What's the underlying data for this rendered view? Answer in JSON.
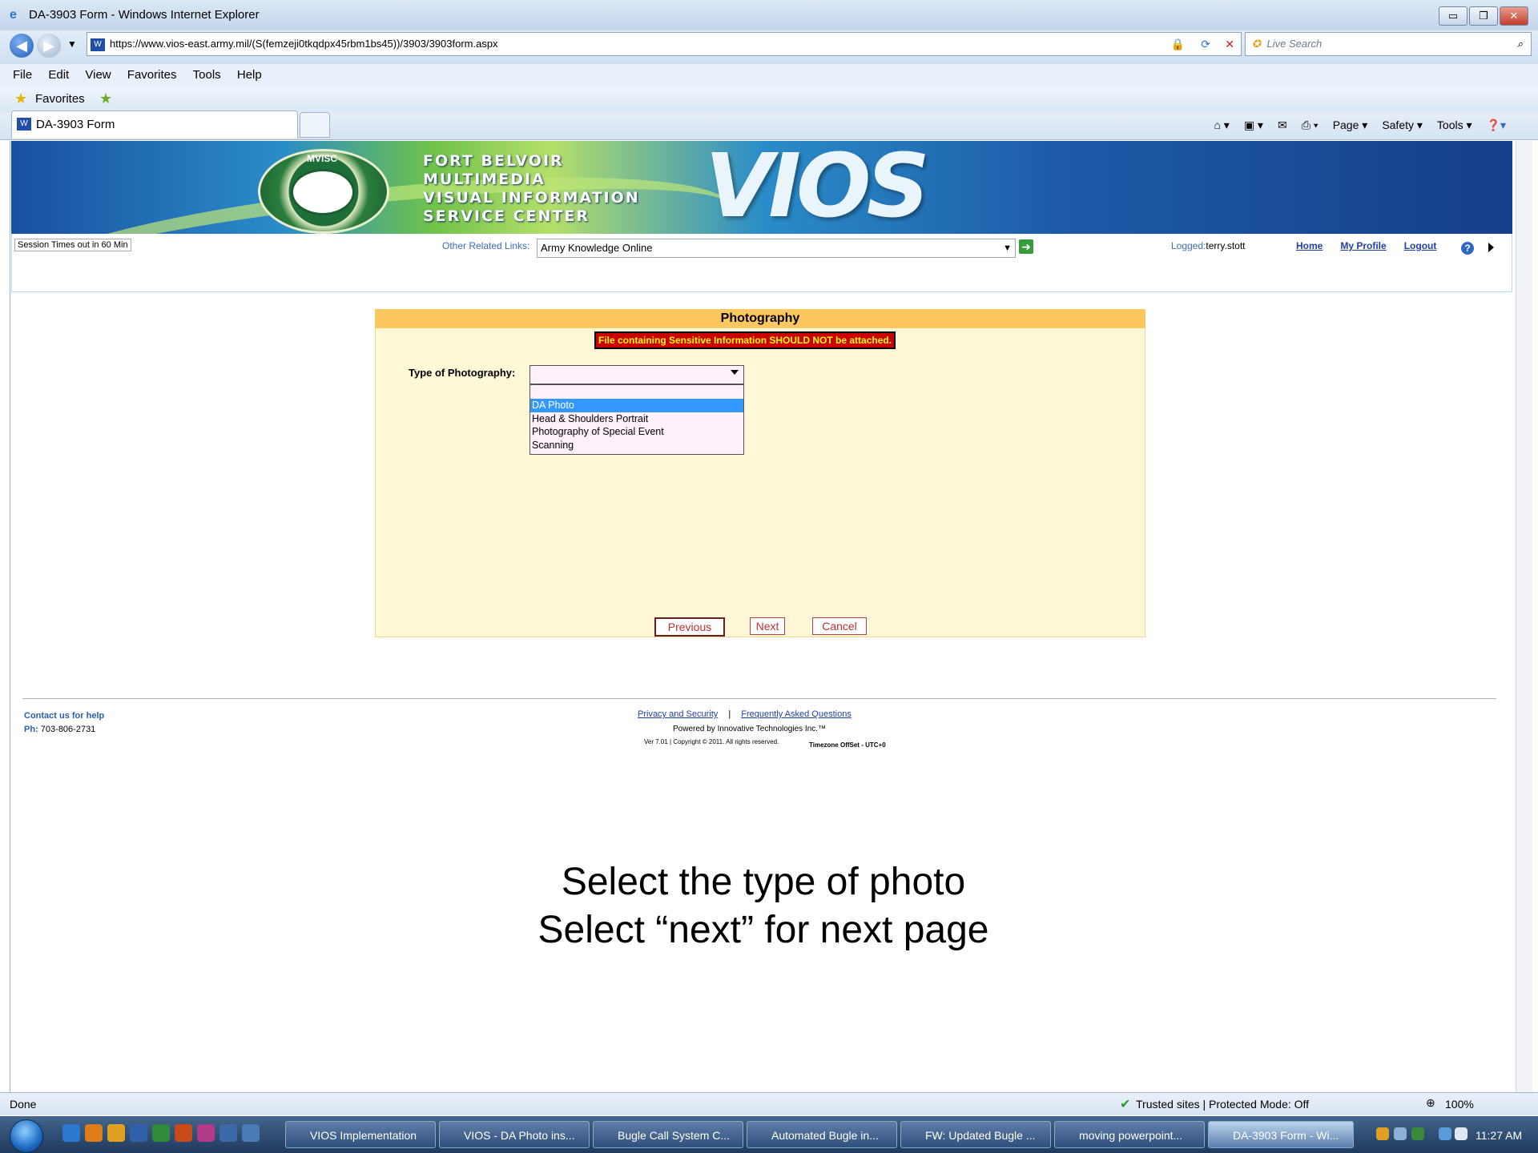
{
  "window": {
    "title": "DA-3903 Form - Windows Internet Explorer",
    "min": "▭",
    "max": "❐",
    "close": "✕"
  },
  "addressbar": {
    "url": "https://www.vios-east.army.mil/(S(femzeji0tkqdpx45rbm1bs45))/3903/3903form.aspx",
    "search_placeholder": "Live Search"
  },
  "menu": [
    "File",
    "Edit",
    "View",
    "Favorites",
    "Tools",
    "Help"
  ],
  "favorites": {
    "label": "Favorites"
  },
  "tab": {
    "label": "DA-3903 Form"
  },
  "commandbar": [
    "Page ▾",
    "Safety ▾",
    "Tools ▾"
  ],
  "banner": {
    "line1": "FORT BELVOIR",
    "line2": "MULTIMEDIA",
    "line3": "VISUAL INFORMATION",
    "line4": "SERVICE CENTER",
    "logo": "VIOS",
    "seal": "MVISC"
  },
  "header": {
    "session": "Session Times out in 60 Min",
    "other_links_label": "Other Related Links:",
    "other_links_value": "Army Knowledge Online",
    "logged_label": "Logged:",
    "logged_user": "terry.stott",
    "home": "Home",
    "profile": "My Profile",
    "logout": "Logout"
  },
  "form": {
    "title": "Photography",
    "warning": "File containing Sensitive Information SHOULD NOT be attached.",
    "type_label": "Type of Photography:",
    "options": [
      "DA Photo",
      "Head & Shoulders Portrait",
      "Photography of Special Event",
      "Scanning"
    ],
    "selected_option": "DA Photo",
    "prev": "Previous",
    "next": "Next",
    "cancel": "Cancel"
  },
  "footer": {
    "contact": "Contact us for help",
    "phone_label": "Ph:",
    "phone": "703-806-2731",
    "privacy": "Privacy and Security",
    "faq": "Frequently Asked Questions",
    "powered": "Powered by Innovative Technologies Inc.™",
    "version": "Ver 7.01 | Copyright © 2011. All rights reserved.",
    "timezone": "Timezone OffSet - UTC+0"
  },
  "instructions": {
    "line1": "Select the type of photo",
    "line2": "Select “next” for next page"
  },
  "statusbar": {
    "status": "Done",
    "zone": "Trusted sites | Protected Mode: Off",
    "zoom": "100%"
  },
  "taskbar": {
    "items": [
      "VIOS Implementation",
      "VIOS - DA Photo ins...",
      "Bugle Call System C...",
      "Automated Bugle in...",
      "FW: Updated Bugle ...",
      "moving powerpoint...",
      "DA-3903 Form - Wi..."
    ],
    "clock": "11:27 AM"
  }
}
